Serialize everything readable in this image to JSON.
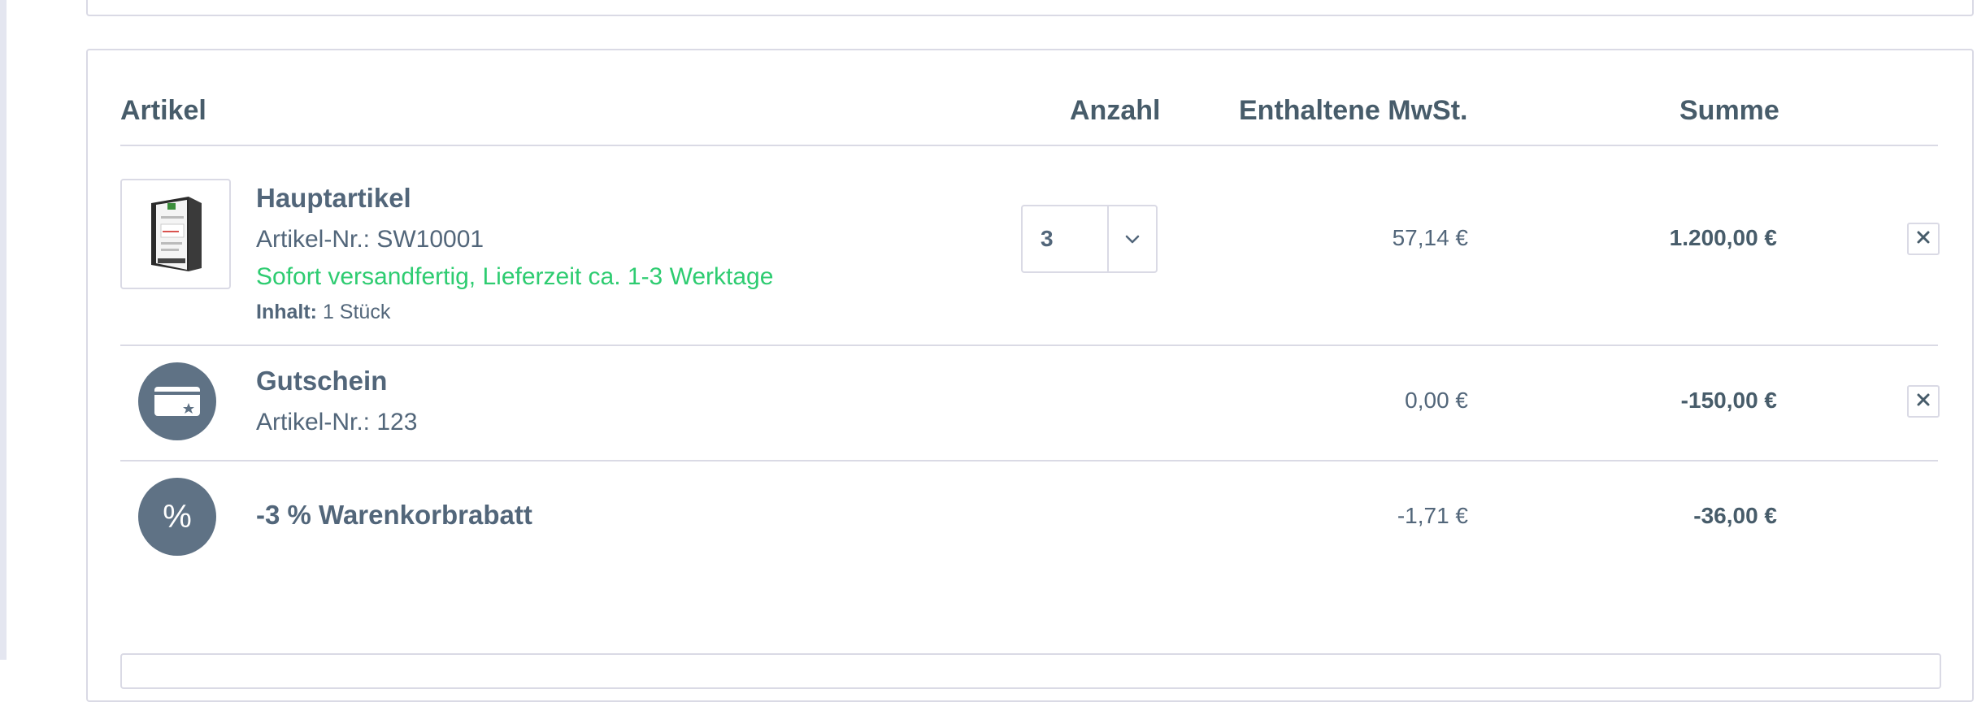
{
  "cart": {
    "headers": {
      "article": "Artikel",
      "quantity": "Anzahl",
      "vat": "Enthaltene MwSt.",
      "total": "Summe"
    },
    "product": {
      "name": "Hauptartikel",
      "number": "Artikel-Nr.: SW10001",
      "delivery": "Sofort versandfertig, Lieferzeit ca. 1-3 Werktage",
      "content_label": "Inhalt:",
      "content_value": "1 Stück",
      "quantity": "3",
      "vat": "57,14 €",
      "total": "1.200,00 €"
    },
    "voucher": {
      "name": "Gutschein",
      "number": "Artikel-Nr.: 123",
      "vat": "0,00 €",
      "total": "-150,00 €",
      "icon": "voucher-card-icon"
    },
    "discount": {
      "name": "-3 % Warenkorbrabatt",
      "symbol": "%",
      "vat": "-1,71 €",
      "total": "-36,00 €",
      "icon": "percent-icon"
    }
  },
  "colors": {
    "accent_green": "#2ecc71",
    "text": "#52667a",
    "border": "#dadae5",
    "icon_bg": "#5f7285"
  }
}
